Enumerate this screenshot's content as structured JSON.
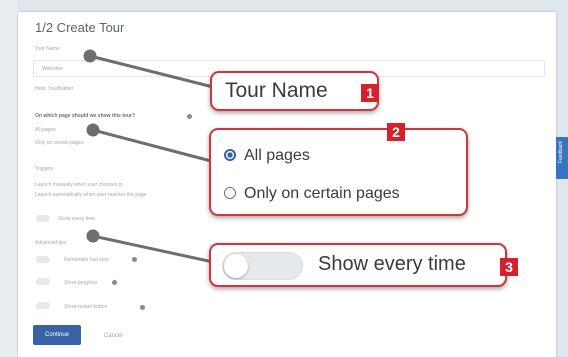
{
  "form": {
    "title": "1/2 Create Tour",
    "tour_name_label": "Tour Name",
    "tour_name_value": "Welcome",
    "tour_name_hint": "Help: TourBuilder",
    "which_page_question": "On which page should we show this tour?",
    "option_all_pages": "All pages",
    "option_certain_pages": "Only on certain pages",
    "trigger_label": "Triggers",
    "trigger_manual": "Launch manually when user chooses to",
    "trigger_auto": "Launch automatically when user reaches the page",
    "show_every_time": "Show every time",
    "advanced_label": "Advanced tips",
    "remember_last_step": "Remember last step",
    "show_progress": "Show progress",
    "show_restart_button": "Show restart button",
    "continue_label": "Continue",
    "cancel_label": "Cancel"
  },
  "side_tab": {
    "label": "Feedback"
  },
  "callouts": [
    {
      "badge": "1",
      "text": "Tour Name"
    },
    {
      "badge": "2",
      "options": [
        "All pages",
        "Only on certain pages"
      ],
      "selected": "All pages"
    },
    {
      "badge": "3",
      "text": "Show every time",
      "toggle_on": false
    }
  ],
  "colors": {
    "badge": "#d6202b",
    "callout_border": "#d1343b",
    "primary": "#3a62a6",
    "accent": "#3a73c4"
  },
  "icons": [
    "radio-checked-icon",
    "radio-unchecked-icon",
    "help-icon",
    "toggle-icon"
  ]
}
